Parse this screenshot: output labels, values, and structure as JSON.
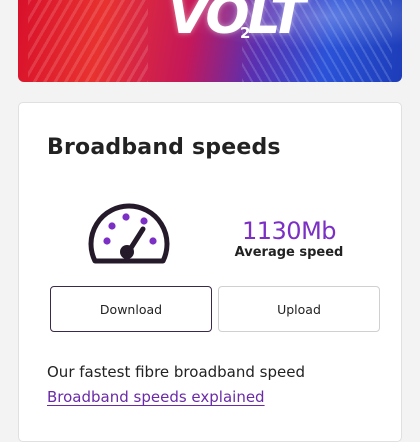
{
  "banner": {
    "logo_text": "VOLT",
    "logo_sub": "2"
  },
  "card": {
    "title": "Broadband speeds",
    "speed_value": "1130Mb",
    "speed_label": "Average speed",
    "download_label": "Download",
    "upload_label": "Upload",
    "description": "Our fastest fibre broadband speed",
    "link_text": "Broadband speeds explained"
  },
  "icons": {
    "gauge": "speedometer-icon"
  },
  "colors": {
    "accent": "#7b2fc4",
    "link": "#6a2aa8",
    "text": "#222222"
  }
}
